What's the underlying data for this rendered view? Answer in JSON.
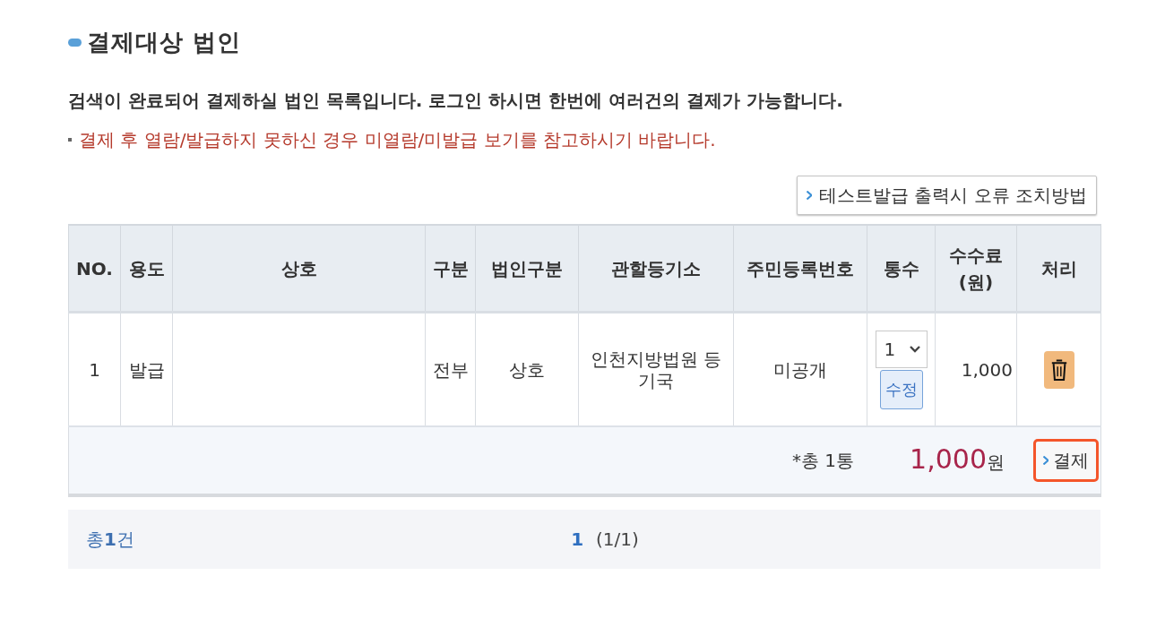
{
  "section": {
    "title": "결제대상 법인"
  },
  "intro": {
    "text": "검색이 완료되어 결제하실 법인 목록입니다. 로그인 하시면 한번에 여러건의 결제가 가능합니다.",
    "note": "결제 후 열람/발급하지 못하신 경우 미열람/미발급 보기를 참고하시기 바랍니다."
  },
  "help_button": {
    "label": "테스트발급 출력시 오류 조치방법"
  },
  "table": {
    "columns": [
      {
        "label": "NO."
      },
      {
        "label": "용도"
      },
      {
        "label": "상호"
      },
      {
        "label": "구분"
      },
      {
        "label": "법인구분"
      },
      {
        "label": "관할등기소"
      },
      {
        "label": "주민등록번호"
      },
      {
        "label": "통수"
      },
      {
        "label": "수수료",
        "sub": "(원)"
      },
      {
        "label": "처리"
      }
    ],
    "rows": [
      {
        "no": "1",
        "purpose": "발급",
        "type": "전부",
        "corp_type": "상호",
        "registry": "인천지방법원 등기국",
        "resident_no": "미공개",
        "copies": {
          "value": "1",
          "edit_label": "수정"
        },
        "fee": "1,000"
      }
    ],
    "summary": {
      "copies": "*총 1통",
      "amount": "1,000",
      "currency": "원",
      "pay_button": {
        "label": "결제",
        "highlighted": true
      }
    }
  },
  "pagination": {
    "total": "총**1**건",
    "pages": [
      {
        "label": "1",
        "selected": true
      }
    ],
    "position": "(1/1)"
  }
}
